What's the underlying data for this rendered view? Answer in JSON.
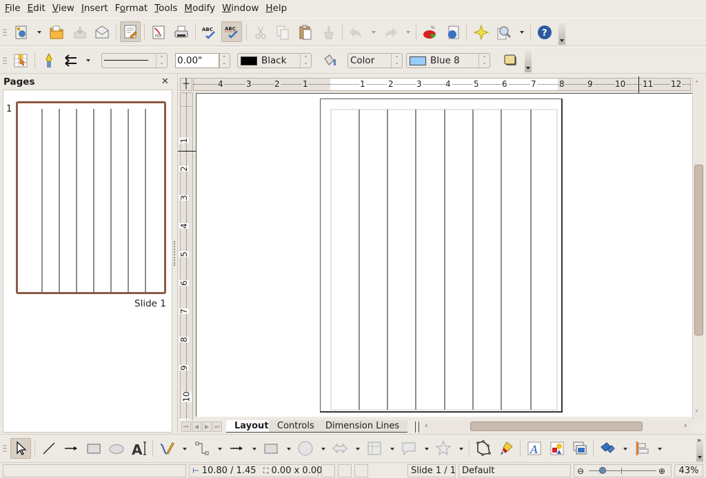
{
  "menubar": {
    "items": [
      {
        "label": "File",
        "mnemonic": "F",
        "rest": "ile"
      },
      {
        "label": "Edit",
        "mnemonic": "E",
        "rest": "dit"
      },
      {
        "label": "View",
        "mnemonic": "V",
        "rest": "iew"
      },
      {
        "label": "Insert",
        "mnemonic": "I",
        "rest": "nsert"
      },
      {
        "label": "Format",
        "pre": "F",
        "mnemonic": "o",
        "rest": "rmat"
      },
      {
        "label": "Tools",
        "mnemonic": "T",
        "rest": "ools"
      },
      {
        "label": "Modify",
        "mnemonic": "M",
        "rest": "odify"
      },
      {
        "label": "Window",
        "mnemonic": "W",
        "rest": "indow"
      },
      {
        "label": "Help",
        "mnemonic": "H",
        "rest": "elp"
      }
    ]
  },
  "standard_toolbar": {
    "icons": [
      "new-document-icon",
      "open-folder-icon",
      "save-icon",
      "email-icon",
      "edit-file-icon",
      "export-pdf-icon",
      "print-icon",
      "spellcheck-icon",
      "autospellcheck-icon",
      "cut-icon",
      "copy-icon",
      "paste-icon",
      "clone-formatting-icon",
      "undo-icon",
      "redo-icon",
      "chart-icon",
      "hyperlink-icon",
      "gallery-icon",
      "zoom-icon",
      "help-icon"
    ],
    "active": [
      "edit-file-icon",
      "autospellcheck-icon"
    ]
  },
  "line_fill_toolbar": {
    "line_width": "0.00\"",
    "line_color": {
      "label": "Black",
      "hex": "#000000"
    },
    "area_style": "Color",
    "area_color": {
      "label": "Blue 8",
      "hex": "#99ccff"
    },
    "shadow_color": "#f0dc96"
  },
  "pages_panel": {
    "title": "Pages",
    "close_glyph": "✕",
    "slides": [
      {
        "number": "1",
        "name": "Slide 1"
      }
    ]
  },
  "rulers": {
    "horizontal": [
      "4",
      "3",
      "2",
      "1",
      "1",
      "2",
      "3",
      "4",
      "5",
      "6",
      "7",
      "8",
      "9",
      "10",
      "11",
      "12"
    ],
    "vertical": [
      "1",
      "2",
      "3",
      "4",
      "5",
      "6",
      "7",
      "8",
      "9",
      "10",
      "1"
    ]
  },
  "layer_tabs": [
    {
      "label": "Layout",
      "active": true
    },
    {
      "label": "Controls",
      "active": false
    },
    {
      "label": "Dimension Lines",
      "active": false
    }
  ],
  "statusbar": {
    "position": "10.80 / 1.45",
    "size": "0.00 x 0.00",
    "slide": "Slide 1 / 1",
    "master": "Default",
    "zoom": "43%",
    "zoom_slider_fraction": 0.2
  },
  "drawing_toolbar": {
    "icons": [
      "select-icon",
      "line-icon",
      "arrow-line-icon",
      "rectangle-icon",
      "ellipse-icon",
      "text-icon",
      "curve-icon",
      "connector-icon",
      "lines-arrows-icon",
      "basic-shapes-icon",
      "symbol-shapes-icon",
      "block-arrows-icon",
      "flowchart-icon",
      "callouts-icon",
      "stars-icon",
      "points-icon",
      "glue-points-icon",
      "fontwork-icon",
      "insert-image-icon",
      "insert-frame-icon",
      "extrusion-icon",
      "align-icon"
    ]
  }
}
